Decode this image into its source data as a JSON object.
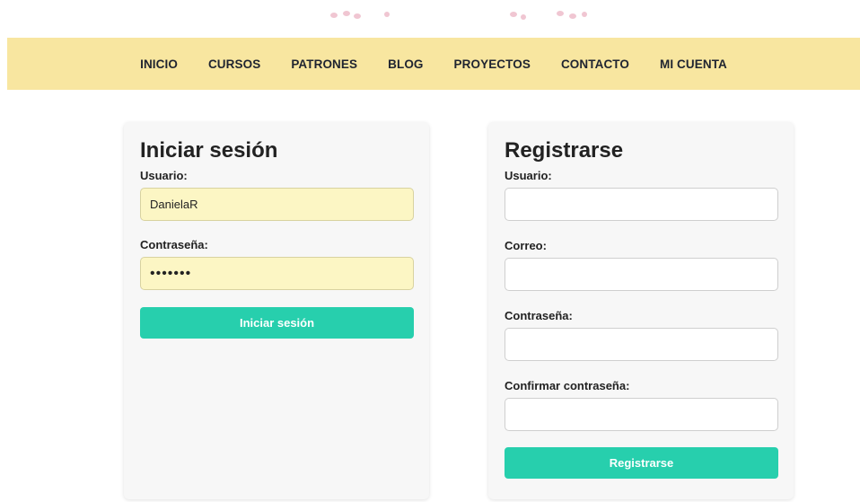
{
  "nav": {
    "items": [
      {
        "label": "INICIO"
      },
      {
        "label": "CURSOS"
      },
      {
        "label": "PATRONES"
      },
      {
        "label": "BLOG"
      },
      {
        "label": "PROYECTOS"
      },
      {
        "label": "CONTACTO"
      },
      {
        "label": "MI CUENTA"
      }
    ]
  },
  "login": {
    "title": "Iniciar sesión",
    "username_label": "Usuario:",
    "username_value": "DanielaR",
    "password_label": "Contraseña:",
    "password_value": "•••••••",
    "submit_label": "Iniciar sesión"
  },
  "register": {
    "title": "Registrarse",
    "username_label": "Usuario:",
    "email_label": "Correo:",
    "password_label": "Contraseña:",
    "confirm_label": "Confirmar contraseña:",
    "submit_label": "Registrarse"
  },
  "colors": {
    "navbar_bg": "#f8e6a0",
    "button_accent": "#27cfad",
    "autofill_bg": "#fcf6c4"
  }
}
